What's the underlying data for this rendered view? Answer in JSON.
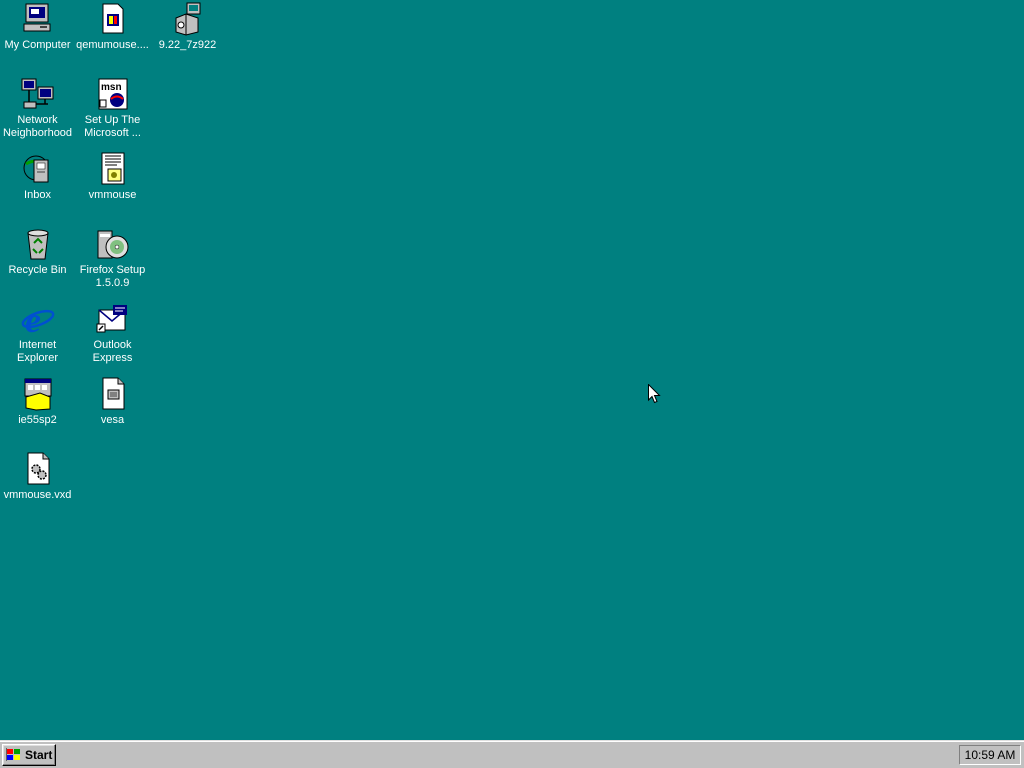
{
  "desktop": {
    "background_color": "#008080",
    "icons": [
      {
        "label": "My Computer",
        "icon": "my-computer-icon"
      },
      {
        "label": "qemumouse....",
        "icon": "setup-file-icon"
      },
      {
        "label": "9.22_7z922",
        "icon": "installer-package-icon"
      },
      {
        "label": "Network\nNeighborhood",
        "icon": "network-neighborhood-icon"
      },
      {
        "label": "Set Up The\nMicrosoft ...",
        "icon": "msn-setup-icon"
      },
      {
        "label": "Inbox",
        "icon": "inbox-icon"
      },
      {
        "label": "vmmouse",
        "icon": "setup-information-file-icon"
      },
      {
        "label": "Recycle Bin",
        "icon": "recycle-bin-icon"
      },
      {
        "label": "Firefox Setup\n1.5.0.9",
        "icon": "firefox-setup-icon"
      },
      {
        "label": "Internet\nExplorer",
        "icon": "internet-explorer-icon"
      },
      {
        "label": "Outlook\nExpress",
        "icon": "outlook-express-icon"
      },
      {
        "label": "ie55sp2",
        "icon": "ie-setup-icon"
      },
      {
        "label": "vesa",
        "icon": "document-file-icon"
      },
      {
        "label": "vmmouse.vxd",
        "icon": "system-file-icon"
      }
    ]
  },
  "taskbar": {
    "start_label": "Start",
    "clock": "10:59 AM",
    "background_color": "#c0c0c0"
  }
}
